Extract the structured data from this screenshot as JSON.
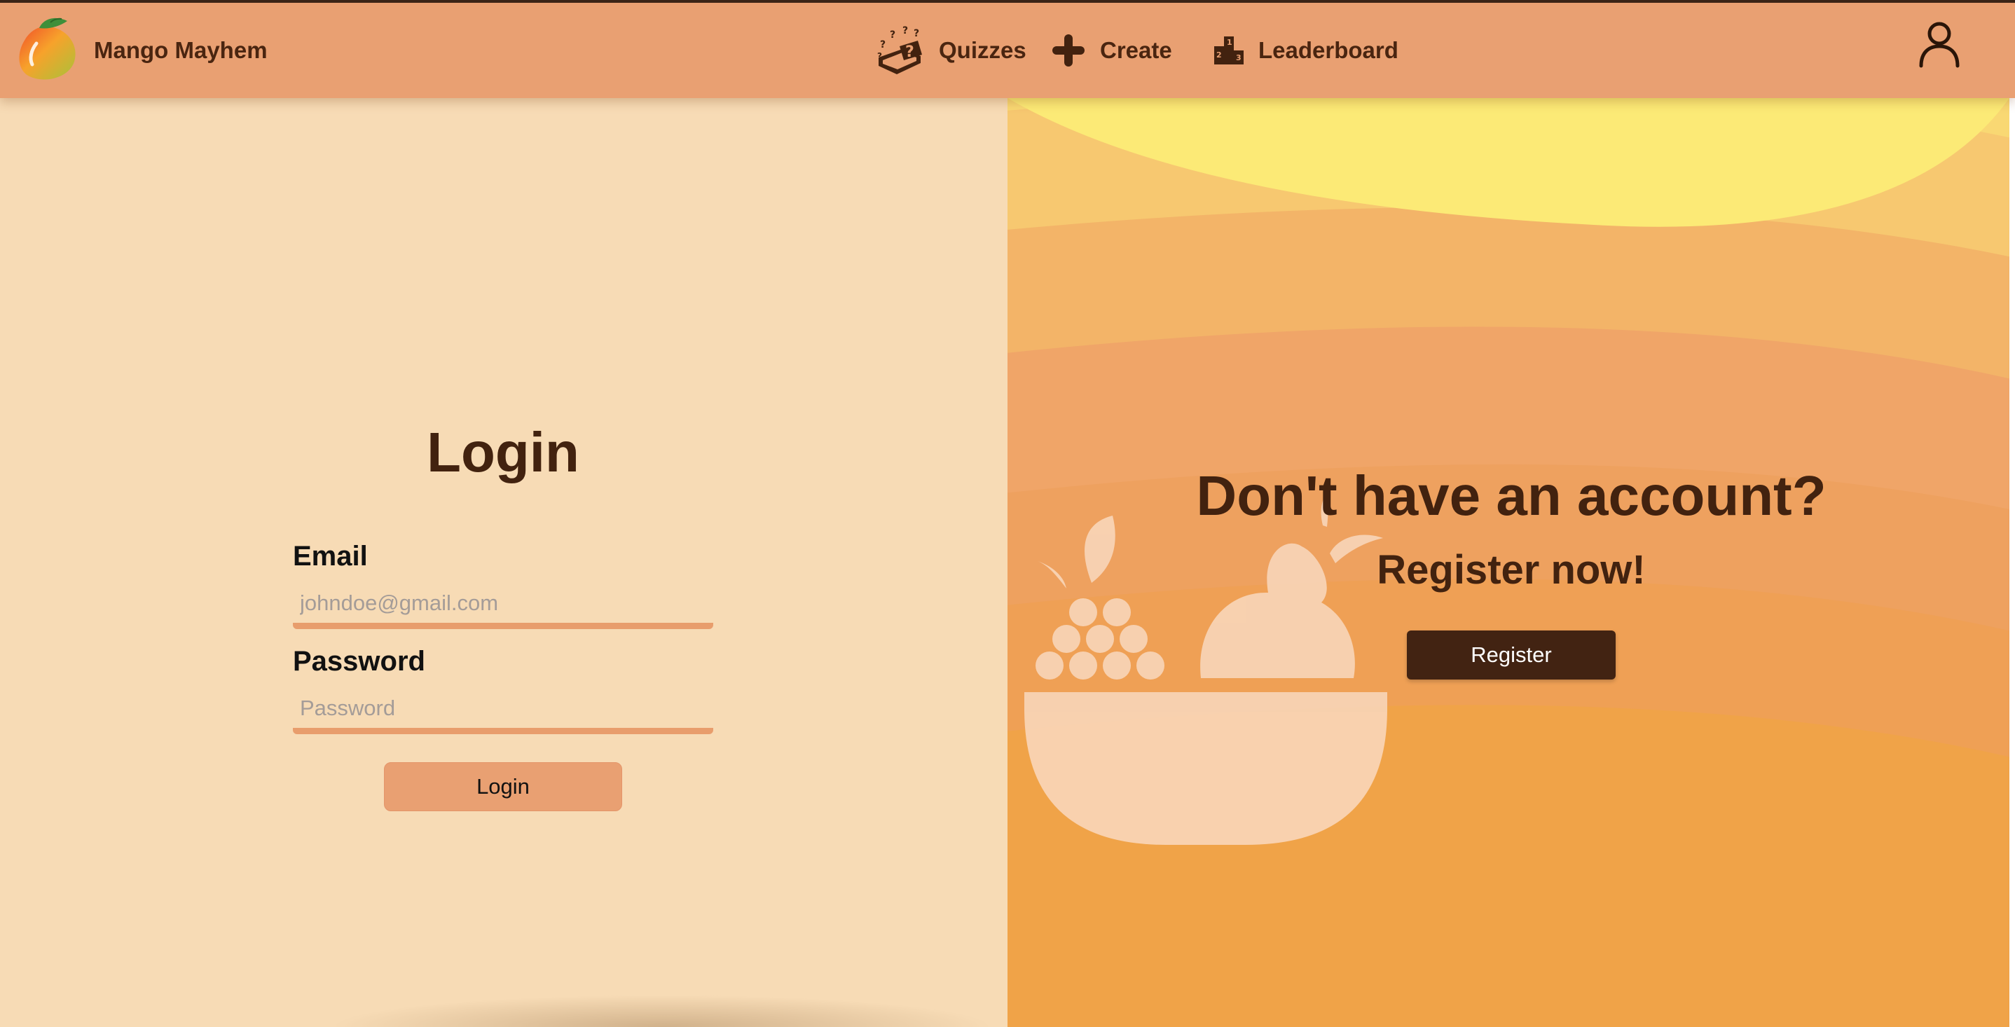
{
  "app": {
    "name": "Mango Mayhem",
    "logo_icon": "mango-icon"
  },
  "nav": {
    "items": [
      {
        "label": "Quizzes",
        "icon": "quiz-box-icon"
      },
      {
        "label": "Create",
        "icon": "plus-icon"
      },
      {
        "label": "Leaderboard",
        "icon": "podium-icon"
      }
    ],
    "profile_icon": "user-icon"
  },
  "login": {
    "title": "Login",
    "email_label": "Email",
    "email_placeholder": "johndoe@gmail.com",
    "email_value": "",
    "password_label": "Password",
    "password_placeholder": "Password",
    "password_value": "",
    "button_label": "Login"
  },
  "register": {
    "heading": "Don't have an account?",
    "subheading": "Register now!",
    "button_label": "Register",
    "illustration_icon": "fruit-bowl-icon"
  },
  "colors": {
    "navbar": "#e9a072",
    "left_panel": "#f7dbb5",
    "text_dark": "#42220f",
    "register_button": "#422312",
    "input_underline": "#e89d6c"
  }
}
